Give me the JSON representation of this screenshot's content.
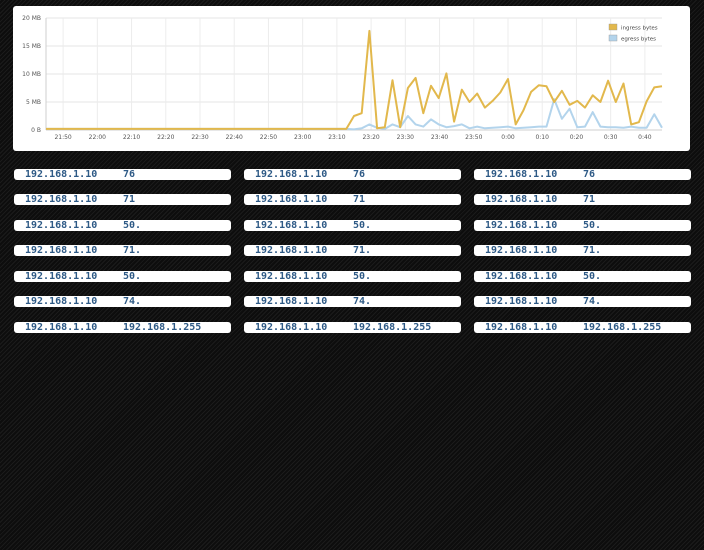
{
  "chart_data": {
    "type": "line",
    "x_tick_labels": [
      "21:50",
      "22:00",
      "22:10",
      "22:20",
      "22:30",
      "22:40",
      "22:50",
      "23:00",
      "23:10",
      "23:20",
      "23:30",
      "23:40",
      "23:50",
      "0:00",
      "0:10",
      "0:20",
      "0:30",
      "0:40"
    ],
    "y_tick_labels": [
      "0 B",
      "5 MB",
      "10 MB",
      "15 MB",
      "20 MB"
    ],
    "ylim": [
      0,
      20
    ],
    "xlim": [
      0,
      71
    ],
    "x_unit": "10-minute tick index",
    "legend_position": "top-right",
    "grid": true,
    "series": [
      {
        "name": "ingress bytes",
        "color": "#e2b84c",
        "values": [
          0.2,
          0.2,
          0.2,
          0.2,
          0.2,
          0.2,
          0.2,
          0.2,
          0.2,
          0.2,
          0.2,
          0.2,
          0.2,
          0.2,
          0.2,
          0.2,
          0.2,
          0.2,
          0.2,
          0.2,
          0.2,
          0.2,
          0.2,
          0.2,
          0.2,
          0.2,
          0.2,
          0.2,
          0.2,
          0.2,
          0.2,
          0.2,
          0.2,
          0.2,
          0.2,
          0.2,
          0.2,
          0.2,
          0.2,
          0.2,
          2.5,
          3.0,
          17.7,
          0.3,
          0.5,
          8.9,
          0.5,
          7.5,
          9.3,
          3.0,
          7.9,
          5.7,
          10.1,
          1.5,
          7.2,
          5.0,
          6.5,
          4.0,
          5.2,
          6.7,
          9.1,
          1.0,
          3.5,
          6.8,
          8.0,
          7.8,
          5.0,
          7.0,
          4.5,
          5.2,
          4.0,
          6.2,
          5.0,
          8.8,
          5.0,
          8.3,
          1.0,
          1.4,
          5.1,
          7.6,
          7.8
        ]
      },
      {
        "name": "egress bytes",
        "color": "#b3d4ec",
        "values": [
          0.2,
          0.2,
          0.2,
          0.2,
          0.2,
          0.2,
          0.2,
          0.2,
          0.2,
          0.2,
          0.2,
          0.2,
          0.2,
          0.2,
          0.2,
          0.2,
          0.2,
          0.2,
          0.2,
          0.2,
          0.2,
          0.2,
          0.2,
          0.2,
          0.2,
          0.2,
          0.2,
          0.2,
          0.2,
          0.2,
          0.2,
          0.2,
          0.2,
          0.2,
          0.2,
          0.2,
          0.2,
          0.2,
          0.2,
          0.2,
          0.1,
          0.3,
          1.0,
          0.4,
          0.2,
          1.0,
          0.5,
          2.5,
          1.0,
          0.6,
          1.9,
          1.0,
          0.5,
          0.7,
          1.0,
          0.3,
          0.6,
          0.3,
          0.4,
          0.5,
          0.6,
          0.3,
          0.4,
          0.5,
          0.6,
          0.6,
          5.5,
          2.0,
          3.8,
          0.5,
          0.6,
          3.2,
          0.6,
          0.5,
          0.5,
          0.4,
          0.6,
          0.4,
          0.4,
          2.8,
          0.4
        ]
      }
    ]
  },
  "connections": [
    [
      {
        "src": "192.168.1.10",
        "dst": "76"
      },
      {
        "src": "192.168.1.10",
        "dst": "71"
      },
      {
        "src": "192.168.1.10",
        "dst": "50."
      },
      {
        "src": "192.168.1.10",
        "dst": "71."
      },
      {
        "src": "192.168.1.10",
        "dst": "50."
      },
      {
        "src": "192.168.1.10",
        "dst": "74."
      },
      {
        "src": "192.168.1.10",
        "dst": "192.168.1.255"
      }
    ],
    [
      {
        "src": "192.168.1.10",
        "dst": "76"
      },
      {
        "src": "192.168.1.10",
        "dst": "71"
      },
      {
        "src": "192.168.1.10",
        "dst": "50."
      },
      {
        "src": "192.168.1.10",
        "dst": "71."
      },
      {
        "src": "192.168.1.10",
        "dst": "50."
      },
      {
        "src": "192.168.1.10",
        "dst": "74."
      },
      {
        "src": "192.168.1.10",
        "dst": "192.168.1.255"
      }
    ],
    [
      {
        "src": "192.168.1.10",
        "dst": "76"
      },
      {
        "src": "192.168.1.10",
        "dst": "71"
      },
      {
        "src": "192.168.1.10",
        "dst": "50."
      },
      {
        "src": "192.168.1.10",
        "dst": "71."
      },
      {
        "src": "192.168.1.10",
        "dst": "50."
      },
      {
        "src": "192.168.1.10",
        "dst": "74."
      },
      {
        "src": "192.168.1.10",
        "dst": "192.168.1.255"
      }
    ]
  ]
}
